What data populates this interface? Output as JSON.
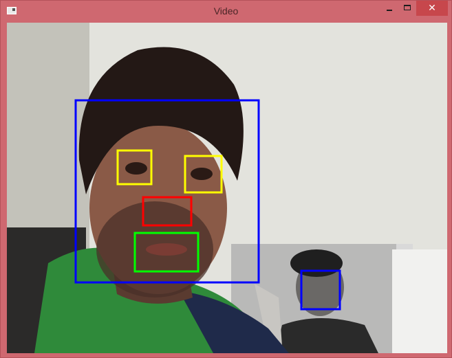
{
  "window": {
    "title": "Video",
    "close_glyph": "✕",
    "frame_color": "#cf6870"
  },
  "icons": {
    "app": "app-window-icon",
    "minimize": "minimize-icon",
    "maximize": "maximize-icon",
    "close": "close-icon"
  },
  "detections": {
    "colors": {
      "face": "#0000ff",
      "eye": "#ffff00",
      "nose": "#ff0000",
      "mouth": "#00ff00"
    }
  }
}
